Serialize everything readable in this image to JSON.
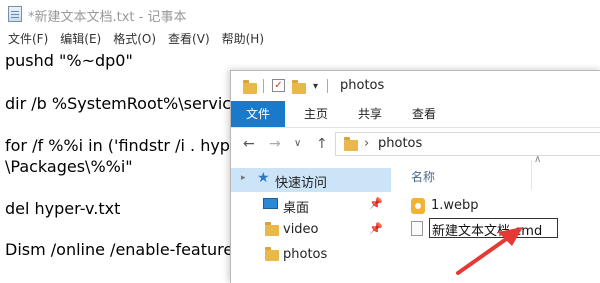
{
  "notepad": {
    "title": "*新建文本文档.txt - 记事本",
    "menu": [
      "文件(F)",
      "编辑(E)",
      "格式(O)",
      "查看(V)",
      "帮助(H)"
    ],
    "lines": [
      "pushd \"%~dp0\"",
      "",
      "dir /b %SystemRoot%\\servici",
      "",
      "for /f %%i in ('findstr /i . hype",
      "\\Packages\\%%i\"",
      "",
      "del hyper-v.txt",
      "",
      "Dism /online /enable-feature"
    ]
  },
  "explorer": {
    "title": "photos",
    "ribbon_tabs": [
      "文件",
      "主页",
      "共享",
      "查看"
    ],
    "address": {
      "path": "photos"
    },
    "nav_items": [
      {
        "label": "快速访问",
        "icon": "star-icon"
      },
      {
        "label": "桌面",
        "icon": "desktop-icon"
      },
      {
        "label": "video",
        "icon": "folder-icon"
      },
      {
        "label": "photos",
        "icon": "folder-icon"
      }
    ],
    "column_header": "名称",
    "files": [
      {
        "name": "1.webp",
        "icon": "webp-file-icon"
      },
      {
        "name": "新建文本文档.cmd",
        "icon": "text-file-icon"
      }
    ]
  },
  "colors": {
    "accent": "#1979ca",
    "arrow": "#e53935",
    "nav_selected": "#cce4f7"
  }
}
